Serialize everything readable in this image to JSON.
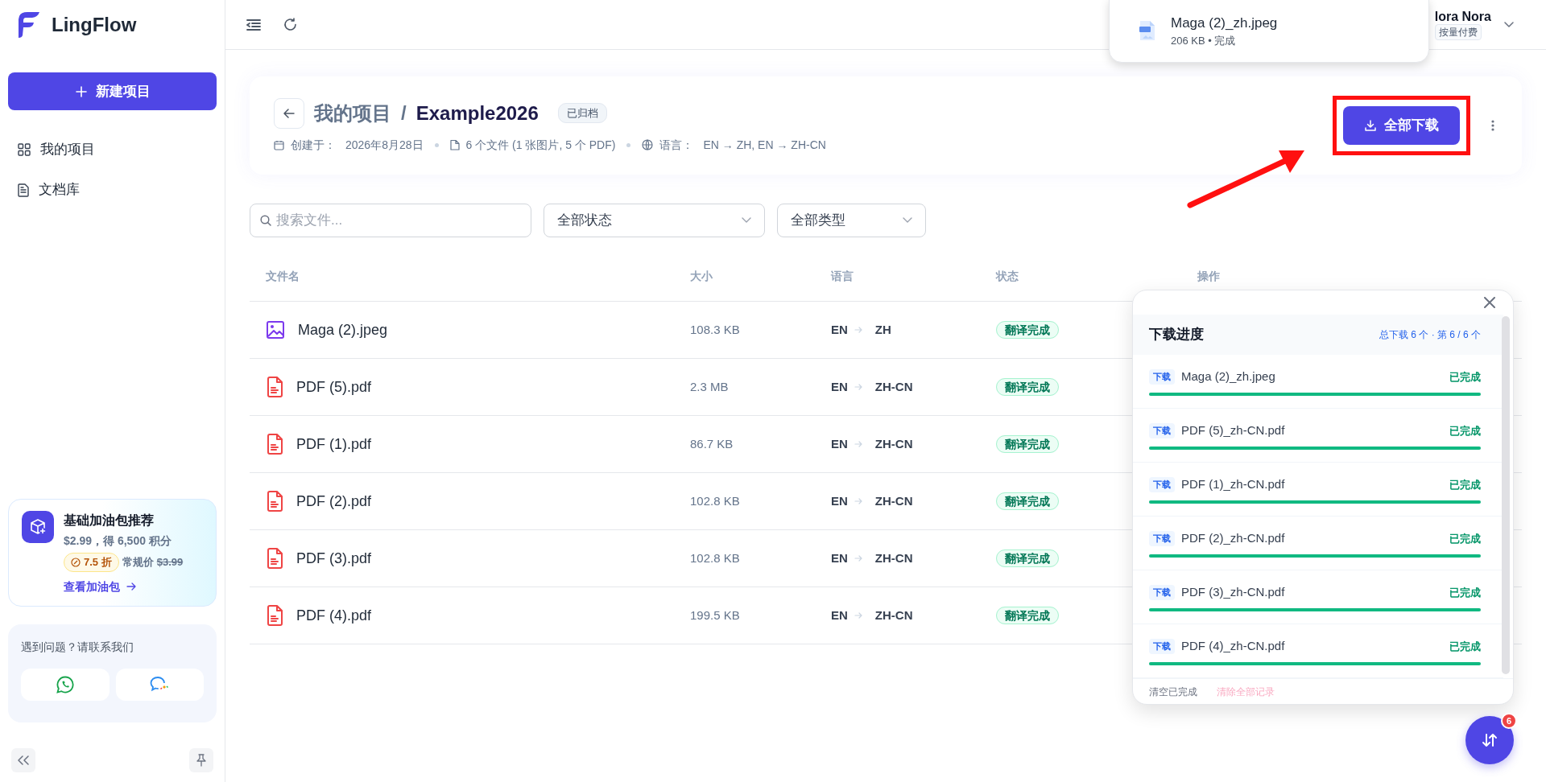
{
  "app": {
    "logo": "LingFlow"
  },
  "sidebar": {
    "new_button": "新建项目",
    "items": [
      {
        "label": "我的项目",
        "selected": false
      },
      {
        "label": "文档库",
        "selected": false
      }
    ],
    "promo": {
      "title": "基础加油包推荐",
      "price_line": "$2.99，得 6,500 积分",
      "discount": "7.5 折",
      "regular_label": "常规价",
      "regular_price": "$3.99",
      "link": "查看加油包"
    },
    "support": {
      "text": "遇到问题？请联系我们"
    }
  },
  "user": {
    "name": "lora Nora",
    "plan": "按量付费"
  },
  "toast": {
    "file": "Maga (2)_zh.jpeg",
    "detail": "206 KB • 完成"
  },
  "project": {
    "breadcrumb": "我的项目",
    "separator": "/",
    "name": "Example2026",
    "badge": "已归档",
    "created_label": "创建于：",
    "created": "2026年8月28日",
    "files": "6 个文件 (1 张图片, 5 个 PDF)",
    "lang_label": "语言：",
    "langs": "EN → ZH, EN → ZH-CN",
    "download_button": "全部下载"
  },
  "filters": {
    "search_placeholder": "搜索文件...",
    "status": "全部状态",
    "type": "全部类型"
  },
  "table": {
    "columns": [
      "文件名",
      "大小",
      "语言",
      "状态",
      "操作"
    ],
    "rows": [
      {
        "kind": "image",
        "name": "Maga (2).jpeg",
        "size": "108.3 KB",
        "source": "EN",
        "target": "ZH",
        "status": "翻译完成"
      },
      {
        "kind": "pdf",
        "name": "PDF (5).pdf",
        "size": "2.3 MB",
        "source": "EN",
        "target": "ZH-CN",
        "status": "翻译完成"
      },
      {
        "kind": "pdf",
        "name": "PDF (1).pdf",
        "size": "86.7 KB",
        "source": "EN",
        "target": "ZH-CN",
        "status": "翻译完成"
      },
      {
        "kind": "pdf",
        "name": "PDF (2).pdf",
        "size": "102.8 KB",
        "source": "EN",
        "target": "ZH-CN",
        "status": "翻译完成"
      },
      {
        "kind": "pdf",
        "name": "PDF (3).pdf",
        "size": "102.8 KB",
        "source": "EN",
        "target": "ZH-CN",
        "status": "翻译完成"
      },
      {
        "kind": "pdf",
        "name": "PDF (4).pdf",
        "size": "199.5 KB",
        "source": "EN",
        "target": "ZH-CN",
        "status": "翻译完成"
      }
    ]
  },
  "download_panel": {
    "title": "下载进度",
    "summary": "总下载 6 个 · 第 6 / 6 个",
    "items": [
      {
        "tag": "下载",
        "name": "Maga (2)_zh.jpeg",
        "status": "已完成",
        "level": 1
      },
      {
        "tag": "下载",
        "name": "PDF (5)_zh-CN.pdf",
        "status": "已完成",
        "level": 1
      },
      {
        "tag": "下载",
        "name": "PDF (1)_zh-CN.pdf",
        "status": "已完成",
        "level": 1
      },
      {
        "tag": "下载",
        "name": "PDF (2)_zh-CN.pdf",
        "status": "已完成",
        "level": 1
      },
      {
        "tag": "下载",
        "name": "PDF (3)_zh-CN.pdf",
        "status": "已完成",
        "level": 1
      },
      {
        "tag": "下载",
        "name": "PDF (4)_zh-CN.pdf",
        "status": "已完成",
        "level": 1
      }
    ],
    "clear_done": "清空已完成",
    "clear_all": "清除全部记录"
  },
  "fab": {
    "badge": "6"
  }
}
